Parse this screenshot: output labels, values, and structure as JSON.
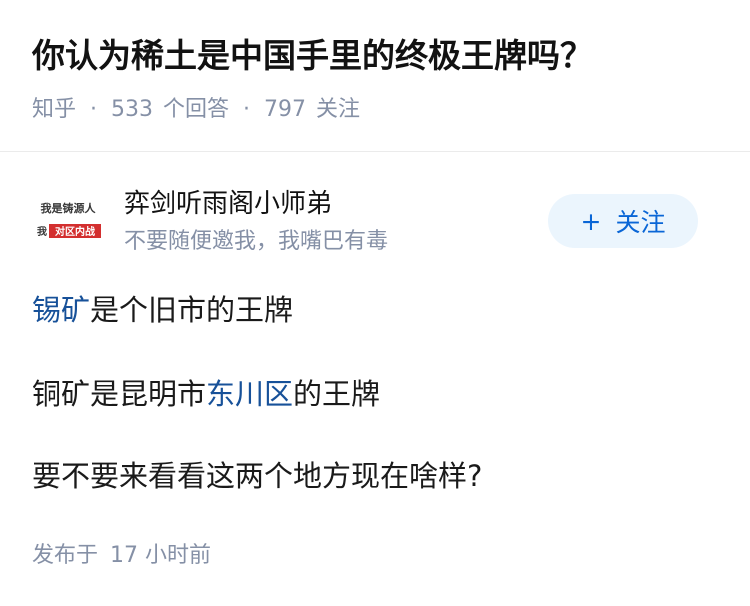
{
  "question": {
    "title": "你认为稀土是中国手里的终极王牌吗？",
    "source": "知乎",
    "answers_count": "533",
    "answers_label": "个回答",
    "followers_count": "797",
    "followers_label": "关注",
    "separator": "·"
  },
  "author": {
    "avatar_text_top": "我是铸源人",
    "avatar_text_bottom_a": "我",
    "avatar_text_bottom_b": "对区内战",
    "name": "弈剑听雨阁小师弟",
    "bio": "不要随便邀我，我嘴巴有毒",
    "follow_icon": "+",
    "follow_label": "关注",
    "colors": {
      "follow_bg": "#ebf5fd",
      "follow_text": "#0a66d6"
    }
  },
  "answer": {
    "line1": {
      "link": "锡矿",
      "rest": "是个旧市的王牌"
    },
    "line2": {
      "pre": "铜矿是昆明市",
      "link": "东川区",
      "post": "的王牌"
    },
    "line3": "要不要来看看这两个地方现在啥样?",
    "colors": {
      "link": "#175199",
      "text": "#1a1a1a"
    }
  },
  "footer": {
    "published_label": "发布于",
    "published_time": "17 小时前"
  }
}
